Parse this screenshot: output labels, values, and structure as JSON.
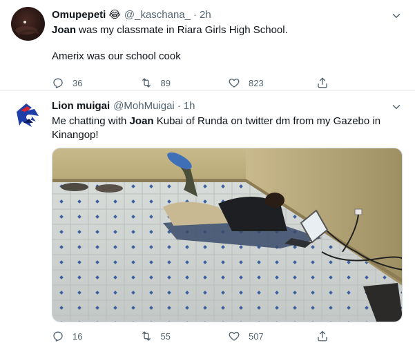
{
  "tweets": [
    {
      "name": "Omupepeti",
      "emoji": "😂",
      "handle": "@_kaschana_",
      "time": "2h",
      "text_bold_1": "Joan",
      "text_rest_1": " was my classmate in Riara Girls High School.",
      "text_2": "Amerix was our school cook",
      "replies": "36",
      "retweets": "89",
      "likes": "823"
    },
    {
      "name": "Lion muigai",
      "handle": "@MohMuigai",
      "time": "1h",
      "text_pre": "Me chatting with ",
      "text_bold": "Joan",
      "text_post": " Kubai of Runda on twitter dm  from my Gazebo in Kinangop!",
      "replies": "16",
      "retweets": "55",
      "likes": "507"
    }
  ],
  "icons": {
    "reply": "reply-icon",
    "retweet": "retweet-icon",
    "like": "heart-icon",
    "share": "share-icon",
    "more": "chevron-down-icon"
  },
  "colors": {
    "secondary_text": "#536471",
    "divider": "#e6ecf0"
  }
}
